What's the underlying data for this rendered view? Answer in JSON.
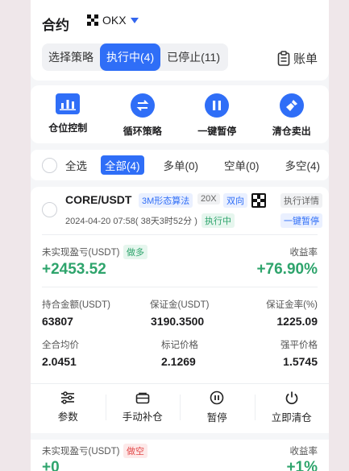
{
  "header": {
    "title": "合约",
    "exchange": "OKX",
    "tabs": [
      {
        "label": "选择策略",
        "active": false
      },
      {
        "label": "执行中(4)",
        "active": true
      },
      {
        "label": "已停止(11)",
        "active": false
      }
    ],
    "bill_label": "账单"
  },
  "actions": [
    {
      "label": "仓位控制",
      "icon": "bar-chart-icon"
    },
    {
      "label": "循环策略",
      "icon": "cycle-arrows-icon"
    },
    {
      "label": "一键暂停",
      "icon": "pause-icon"
    },
    {
      "label": "清仓卖出",
      "icon": "broom-icon"
    }
  ],
  "filter": {
    "select_all": "全选",
    "all": "全部(4)",
    "long": "多单(0)",
    "short": "空单(0)",
    "both": "多空(4)"
  },
  "position": {
    "symbol": "CORE/USDT",
    "strategy_tag": "3M形态算法",
    "leverage": "20X",
    "direction": "双向",
    "detail_link": "执行详情",
    "pause_link": "一键暂停",
    "timestamp": "2024-04-20 07:58( 38天3时52分 )",
    "status": "执行中",
    "pnl_label": "未实现盈亏(USDT)",
    "pnl_side": "做多",
    "pnl_value": "+2453.52",
    "yield_label": "收益率",
    "yield_value": "+76.90%",
    "stats": [
      {
        "label": "持合金额(USDT)",
        "value": "63807"
      },
      {
        "label": "保证金(USDT)",
        "value": "3190.3500"
      },
      {
        "label": "保证金率(%)",
        "value": "1225.09"
      },
      {
        "label": "全合均价",
        "value": "2.0451"
      },
      {
        "label": "标记价格",
        "value": "2.1269"
      },
      {
        "label": "强平价格",
        "value": "1.5745"
      }
    ],
    "ops": [
      {
        "label": "参数",
        "icon": "sliders-icon"
      },
      {
        "label": "手动补仓",
        "icon": "wallet-icon"
      },
      {
        "label": "暂停",
        "icon": "pause-circle-icon"
      },
      {
        "label": "立即清仓",
        "icon": "power-icon"
      }
    ]
  },
  "next_position": {
    "pnl_label": "未实现盈亏(USDT)",
    "pnl_side": "做空",
    "pnl_value": "+0",
    "yield_label": "收益率",
    "yield_value": "+1%"
  },
  "colors": {
    "accent": "#2f6ef7",
    "profit": "#2ea46c",
    "loss": "#e34b4b",
    "background": "#efe7ea"
  }
}
